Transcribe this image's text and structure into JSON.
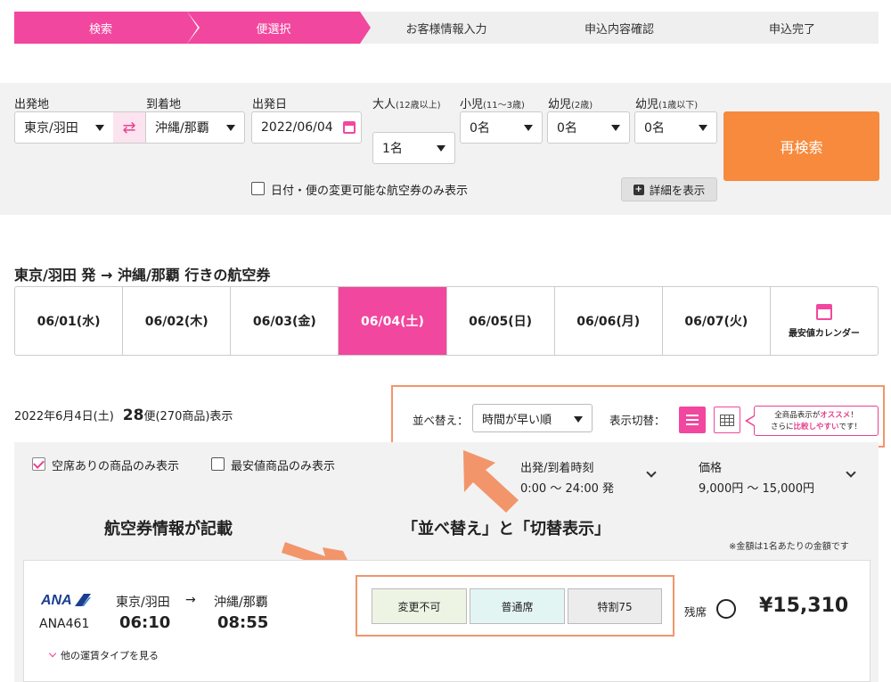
{
  "steps": [
    "検索",
    "便選択",
    "お客様情報入力",
    "申込内容確認",
    "申込完了"
  ],
  "search": {
    "origin_label": "出発地",
    "origin_value": "東京/羽田",
    "dest_label": "到着地",
    "dest_value": "沖縄/那覇",
    "date_label": "出発日",
    "date_value": "2022/06/04",
    "adult_label": "大人",
    "adult_note": "(12歳以上)",
    "adult_value": "1名",
    "child_label": "小児",
    "child_note": "(11〜3歳)",
    "child_value": "0名",
    "infant_label": "幼児",
    "infant_note": "(2歳)",
    "infant_value": "0名",
    "baby_label": "幼児",
    "baby_note": "(1歳以下)",
    "baby_value": "0名",
    "research_label": "再検索",
    "changeable_only_label": "日付・便の変更可能な航空券のみ表示",
    "detail_label": "詳細を表示"
  },
  "route_title": "東京/羽田 発 → 沖縄/那覇 行きの航空券",
  "dates": [
    "06/01(水)",
    "06/02(木)",
    "06/03(金)",
    "06/04(土)",
    "06/05(日)",
    "06/06(月)",
    "06/07(火)"
  ],
  "calendar_label": "最安値カレンダー",
  "results": {
    "date_text": "2022年6月4日(土)",
    "count": "28",
    "count_suffix": "便(270商品)表示"
  },
  "sort": {
    "label": "並べ替え：",
    "value": "時間が早い順",
    "view_label": "表示切替："
  },
  "tip": {
    "line1_pre": "全商品表示が",
    "line1_em": "オススメ",
    "line1_post": "！",
    "line2_pre": "さらに",
    "line2_em": "比較しやすい",
    "line2_post": "です！"
  },
  "filters": {
    "vacant_only": "空席ありの商品のみ表示",
    "cheapest_only": "最安値商品のみ表示",
    "time_label": "出発/到着時刻",
    "time_range": "0:00 〜 24:00 発",
    "price_label": "価格",
    "price_range": "9,000円 〜 15,000円"
  },
  "annotations": {
    "info": "航空券情報が記載",
    "sort_view": "「並べ替え」と「切替表示」"
  },
  "price_note": "※金額は1名あたりの金額です",
  "flight": {
    "airline_logo": "ANA",
    "number": "ANA461",
    "dep_city": "東京/羽田",
    "dep_time": "06:10",
    "arrow": "→",
    "arr_city": "沖縄/那覇",
    "arr_time": "08:55",
    "fares": [
      "変更不可",
      "普通席",
      "特割75"
    ],
    "seats_label": "残席",
    "price": "¥15,310",
    "other_fares": "他の運賃タイプを見る"
  },
  "colors": {
    "accent": "#f2479e",
    "button": "#f78a3c",
    "annotation": "#f2956b"
  }
}
